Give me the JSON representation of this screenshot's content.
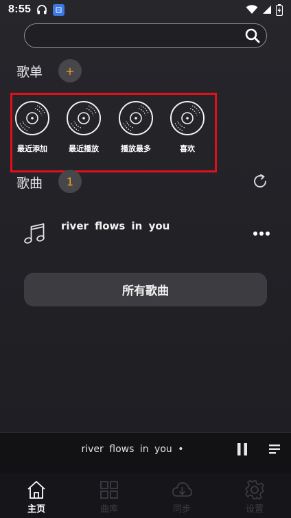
{
  "status_bar": {
    "time": "8:55",
    "app_badge_text": "🖊"
  },
  "search": {
    "placeholder": "",
    "value": ""
  },
  "playlists_section": {
    "title": "歌单",
    "add_label": "+",
    "items": [
      {
        "label": "最近添加",
        "icon": "vinyl-disc-icon"
      },
      {
        "label": "最近播放",
        "icon": "vinyl-disc-icon"
      },
      {
        "label": "播放最多",
        "icon": "vinyl-disc-icon"
      },
      {
        "label": "喜欢",
        "icon": "vinyl-disc-icon"
      }
    ]
  },
  "songs_section": {
    "title": "歌曲",
    "count": "1",
    "refresh_icon": "refresh-icon"
  },
  "songs": [
    {
      "title": "river  flows  in  you",
      "icon": "music-note-icon"
    }
  ],
  "all_songs_button": "所有歌曲",
  "mini_player": {
    "title": "river  flows  in  you •"
  },
  "bottom_nav": {
    "items": [
      {
        "label": "主页",
        "icon": "home-icon",
        "active": true
      },
      {
        "label": "曲库",
        "icon": "grid-icon",
        "active": false
      },
      {
        "label": "同步",
        "icon": "cloud-download-icon",
        "active": false
      },
      {
        "label": "设置",
        "icon": "gear-icon",
        "active": false
      }
    ]
  },
  "colors": {
    "background": "#232328",
    "accent_orange": "#f0a020",
    "highlight_red": "#e2101c",
    "button_gray": "#3d3d41",
    "nav_inactive": "#3c3c42"
  }
}
